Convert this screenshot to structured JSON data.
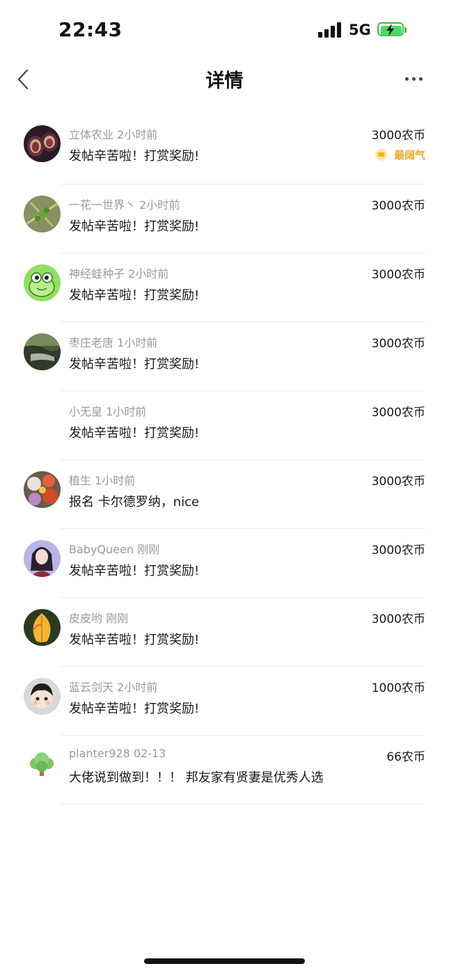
{
  "status_bar": {
    "time": "22:43",
    "network": "5G"
  },
  "nav": {
    "title": "详情"
  },
  "rewards": [
    {
      "user": "立体农业",
      "time": "2小时前",
      "message": "发帖辛苦啦！打赏奖励!",
      "amount": "3000农币",
      "badge": "最阔气",
      "avatar_icon": "fig-fruit-avatar"
    },
    {
      "user": "一花一世界丶",
      "time": "2小时前",
      "message": "发帖辛苦啦！打赏奖励!",
      "amount": "3000农币",
      "badge": "",
      "avatar_icon": "green-plant-avatar"
    },
    {
      "user": "神经蛙种子",
      "time": "2小时前",
      "message": "发帖辛苦啦！打赏奖励!",
      "amount": "3000农币",
      "badge": "",
      "avatar_icon": "cartoon-frog-avatar"
    },
    {
      "user": "枣庄老唐",
      "time": "1小时前",
      "message": "发帖辛苦啦！打赏奖励!",
      "amount": "3000农币",
      "badge": "",
      "avatar_icon": "landscape-avatar"
    },
    {
      "user": "小无皇",
      "time": "1小时前",
      "message": "发帖辛苦啦！打赏奖励!",
      "amount": "3000农币",
      "badge": "",
      "avatar_icon": "blank-avatar"
    },
    {
      "user": "植生",
      "time": "1小时前",
      "message": "报名 卡尔德罗纳，nice",
      "amount": "3000农币",
      "badge": "",
      "avatar_icon": "flowers-avatar"
    },
    {
      "user": "BabyQueen",
      "time": "刚刚",
      "message": "发帖辛苦啦！打赏奖励!",
      "amount": "3000农币",
      "badge": "",
      "avatar_icon": "portrait-avatar"
    },
    {
      "user": "皮皮哟",
      "time": "刚刚",
      "message": "发帖辛苦啦！打赏奖励!",
      "amount": "3000农币",
      "badge": "",
      "avatar_icon": "yellow-leaf-avatar"
    },
    {
      "user": "蓝云剑天",
      "time": "2小时前",
      "message": "发帖辛苦啦！打赏奖励!",
      "amount": "1000农币",
      "badge": "",
      "avatar_icon": "cartoon-girl-avatar"
    },
    {
      "user": "planter928",
      "time": "02-13",
      "message": "大佬说到做到！！！ 邦友家有贤妻是优秀人选",
      "amount": "66农币",
      "badge": "",
      "avatar_icon": "tree-avatar"
    }
  ],
  "colors": {
    "accent_badge": "#f5a623",
    "battery": "#4cd964",
    "meta_text": "#9a9a9a"
  }
}
